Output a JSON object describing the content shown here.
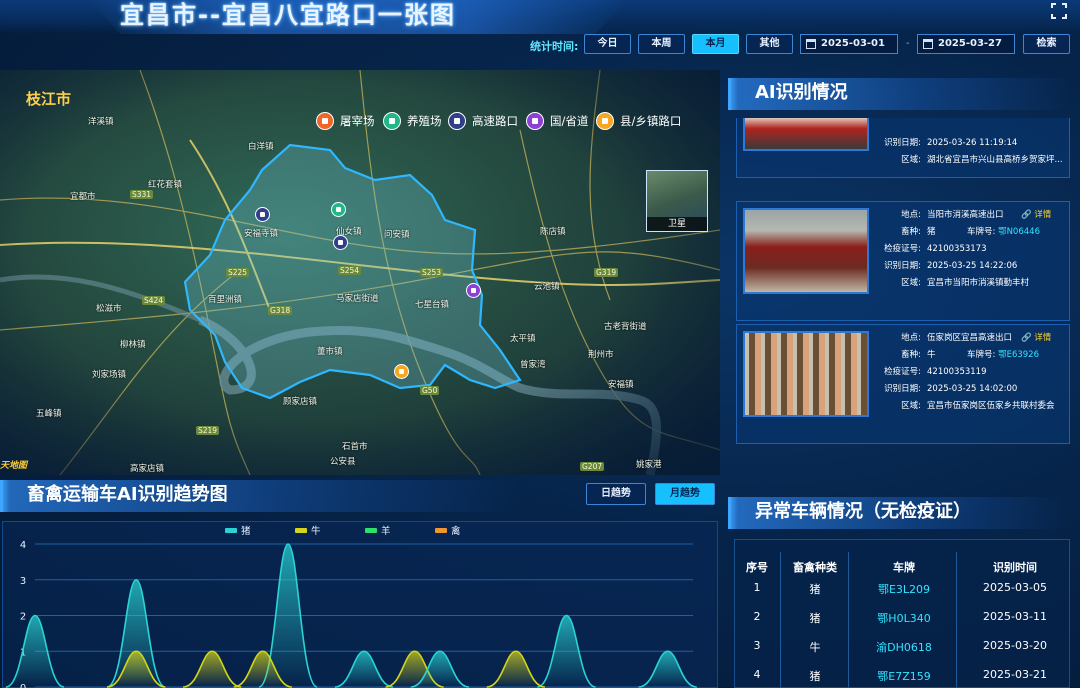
{
  "header": {
    "title": "宜昌市--宜昌八宜路口一张图",
    "stat_label": "统计时间:",
    "buttons": [
      "今日",
      "本周",
      "本月",
      "其他"
    ],
    "active_button": "本月",
    "start_date": "2025-03-01",
    "date_separator": "-",
    "end_date": "2025-03-27",
    "search_label": "检索"
  },
  "map": {
    "city": "枝江市",
    "legend": [
      {
        "label": "屠宰场",
        "color": "#f0662a"
      },
      {
        "label": "养殖场",
        "color": "#1fb886"
      },
      {
        "label": "高速路口",
        "color": "#2f3f8a"
      },
      {
        "label": "国/省道",
        "color": "#8e3fd6"
      },
      {
        "label": "县/乡镇路口",
        "color": "#f5a623"
      }
    ],
    "satellite_label": "卫星",
    "logo": "天地图",
    "place_labels": [
      "安福寺镇",
      "仙女镇",
      "问安镇",
      "七星台镇",
      "马家店街道",
      "百里洲镇",
      "董市镇",
      "顾家店镇",
      "白洋镇",
      "陈店镇",
      "石首市",
      "公安县",
      "刘家场镇",
      "五峰镇",
      "荆州市",
      "古老背街道",
      "云池镇",
      "红花套镇",
      "宜都市",
      "松滋市",
      "太平镇",
      "柳林镇",
      "安福镇",
      "高家店镇",
      "曾家湾",
      "洋溪镇",
      "姚家港"
    ],
    "road_labels": [
      "S225",
      "G318",
      "S254",
      "G50",
      "S253",
      "G319",
      "S331",
      "S424",
      "G207",
      "S219"
    ]
  },
  "ai_panel": {
    "title": "AI识别情况",
    "cards": [
      {
        "fields": [
          {
            "k": "识别日期:",
            "v": "2025-03-26 11:19:14"
          },
          {
            "k": "区域:",
            "v": "湖北省宜昌市兴山县高桥乡贺家坪..."
          }
        ],
        "photo_colors": [
          "#7a6a5a",
          "#c9c2b4",
          "#a8312c"
        ]
      },
      {
        "location": "当阳市消溪高速出口",
        "detail": "详情",
        "species_k": "畜种:",
        "species": "猪",
        "plate_k": "车牌号:",
        "plate": "鄂N06446",
        "cert_k": "检疫证号:",
        "cert": "42100353173",
        "date_k": "识别日期:",
        "date": "2025-03-25 14:22:06",
        "area_k": "区域:",
        "area": "宜昌市当阳市消溪镇勤丰村",
        "loc_k": "地点:"
      },
      {
        "location": "伍家岗区宜昌高速出口",
        "detail": "详情",
        "species_k": "畜种:",
        "species": "牛",
        "plate_k": "车牌号:",
        "plate": "鄂E63926",
        "cert_k": "检疫证号:",
        "cert": "42100353119",
        "date_k": "识别日期:",
        "date": "2025-03-25 14:02:00",
        "area_k": "区域:",
        "area": "宜昌市伍家岗区伍家乡共联村委会",
        "loc_k": "地点:"
      }
    ]
  },
  "trend": {
    "title": "畜禽运输车AI识别趋势图",
    "buttons": [
      "日趋势",
      "月趋势"
    ],
    "active_button": "月趋势"
  },
  "chart_data": {
    "type": "area",
    "title": "",
    "ylim": [
      0,
      4
    ],
    "yticks": [
      0,
      1,
      2,
      3,
      4
    ],
    "series": [
      {
        "name": "猪",
        "color": "#2ad4d4"
      },
      {
        "name": "牛",
        "color": "#d4d419"
      },
      {
        "name": "羊",
        "color": "#2de06a"
      },
      {
        "name": "禽",
        "color": "#f0962a"
      }
    ],
    "peaks": [
      {
        "series": "猪",
        "x_index": 0,
        "value": 2
      },
      {
        "series": "猪",
        "x_index": 4,
        "value": 3
      },
      {
        "series": "牛",
        "x_index": 4,
        "value": 1
      },
      {
        "series": "牛",
        "x_index": 7,
        "value": 1
      },
      {
        "series": "牛",
        "x_index": 9,
        "value": 1
      },
      {
        "series": "猪",
        "x_index": 10,
        "value": 4
      },
      {
        "series": "猪",
        "x_index": 13,
        "value": 1
      },
      {
        "series": "牛",
        "x_index": 15,
        "value": 1
      },
      {
        "series": "猪",
        "x_index": 16,
        "value": 1
      },
      {
        "series": "牛",
        "x_index": 19,
        "value": 1
      },
      {
        "series": "猪",
        "x_index": 21,
        "value": 2
      },
      {
        "series": "猪",
        "x_index": 25,
        "value": 1
      }
    ],
    "x_count": 27
  },
  "abnormal": {
    "title": "异常车辆情况（无检疫证）",
    "columns": [
      "序号",
      "畜禽种类",
      "车牌",
      "识别时间"
    ],
    "rows": [
      [
        "1",
        "猪",
        "鄂E3L209",
        "2025-03-05"
      ],
      [
        "2",
        "猪",
        "鄂H0L340",
        "2025-03-11"
      ],
      [
        "3",
        "牛",
        "渝DH0618",
        "2025-03-20"
      ],
      [
        "4",
        "猪",
        "鄂E7Z159",
        "2025-03-21"
      ]
    ]
  }
}
